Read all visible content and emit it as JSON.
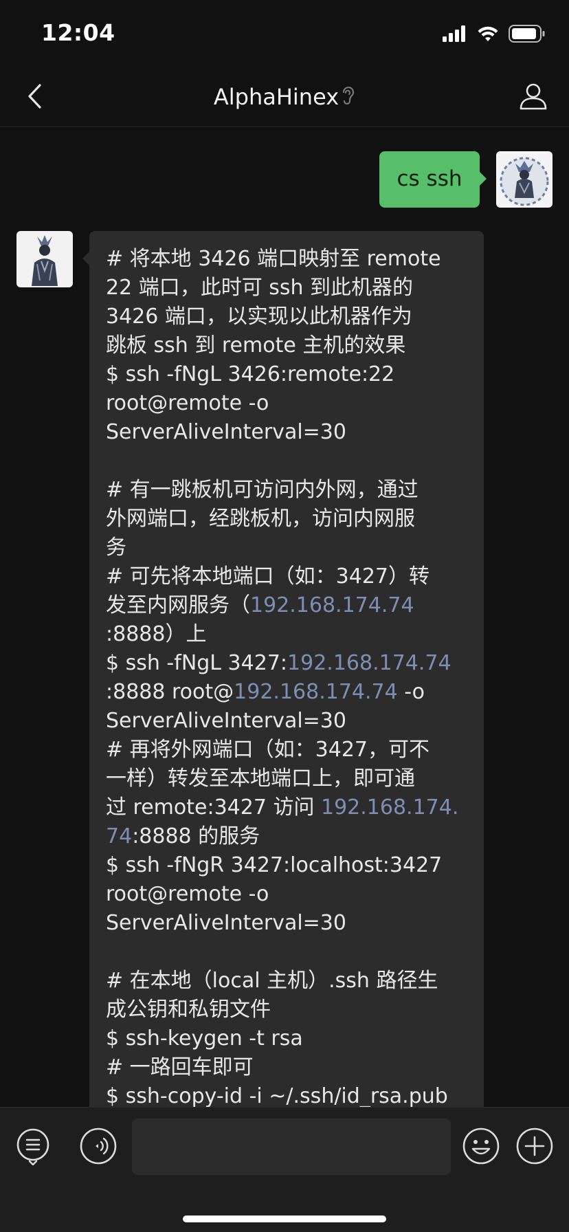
{
  "status_bar": {
    "time": "12:04",
    "icons": [
      "signal-icon",
      "wifi-icon",
      "battery-icon"
    ]
  },
  "nav": {
    "title": "AlphaHinex",
    "icons": [
      "back-chevron-icon",
      "ear-icon",
      "profile-icon"
    ]
  },
  "messages": {
    "outgoing": {
      "text": "cs ssh",
      "color": "#57be6a"
    },
    "incoming": {
      "lines": [
        "# 将本地 3426 端口映射至 remote",
        " 22 端口，此时可 ssh 到此机器的",
        "3426 端口，以实现以此机器作为",
        "跳板 ssh 到 remote 主机的效果",
        "$ ssh -fNgL 3426:remote:22",
        "root@remote -o",
        "ServerAliveInterval=30",
        "",
        "# 有一跳板机可访问内外网，通过",
        "外网端口，经跳板机，访问内网服",
        "务",
        "# 可先将本地端口（如：3427）转",
        "发至内网服务（",
        ":8888）上",
        "$ ssh -fNgL 3427:",
        ":8888 root@",
        "ServerAliveInterval=30",
        "# 再将外网端口（如：3427，可不",
        "一样）转发至本地端口上，即可通",
        "过 remote:3427 访问 ",
        ":8888 的服务",
        "$ ssh -fNgR 3427:localhost:3427",
        "root@remote -o",
        "ServerAliveInterval=30",
        "",
        "# 在本地（local 主机）.ssh 路径生",
        "成公钥和私钥文件",
        "$ ssh-keygen -t rsa",
        "# 一路回车即可",
        "$ ssh-copy-id -i ~/.ssh/id_rsa.pub"
      ],
      "links": {
        "ip_a": "192.168.174.74",
        "ip_b": "192.168.174.74",
        "ip_c": "192.168.174.74",
        "ip_d_part1": "192.168.174.",
        "ip_d_part2": "74",
        "option_o": " -o"
      },
      "link_color": "#7d8fb3"
    }
  },
  "input_bar": {
    "icons": [
      "list-menu-icon",
      "voice-icon",
      "emoji-icon",
      "plus-icon"
    ],
    "text_value": ""
  }
}
